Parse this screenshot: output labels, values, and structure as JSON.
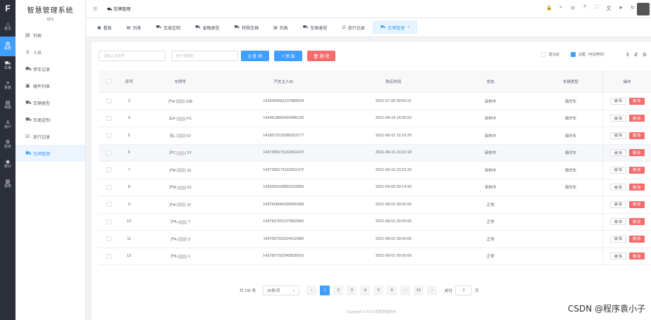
{
  "rail": {
    "logo": "F",
    "items": [
      {
        "icon": "home-icon",
        "glyph": "⌂",
        "label": "首页",
        "active": false
      },
      {
        "icon": "grid-icon",
        "glyph": "▦",
        "label": "系统",
        "active": true
      },
      {
        "icon": "car-icon",
        "glyph": "⛟",
        "label": "车辆",
        "active": false
      },
      {
        "icon": "list-icon",
        "glyph": "≡",
        "label": "看板",
        "active": false
      },
      {
        "icon": "doc-icon",
        "glyph": "▤",
        "label": "档案",
        "active": false
      },
      {
        "icon": "user-icon",
        "glyph": "♙",
        "label": "用户",
        "active": false
      },
      {
        "icon": "setting-icon",
        "glyph": "⚙",
        "label": "财务",
        "active": false
      },
      {
        "icon": "bell-icon",
        "glyph": "◉",
        "label": "统计",
        "active": false
      },
      {
        "icon": "table-icon",
        "glyph": "▥",
        "label": "报表",
        "active": false
      }
    ]
  },
  "side": {
    "title": "智慧管理系统",
    "subtitle": "模块",
    "items": [
      {
        "label": "列表",
        "icon": "▤",
        "active": false
      },
      {
        "label": "人员",
        "icon": "♙",
        "active": false
      },
      {
        "label": "停车记录",
        "icon": "⛟",
        "active": false
      },
      {
        "label": "硬件列表",
        "icon": "▣",
        "active": false
      },
      {
        "label": "车辆类型",
        "icon": "⛟",
        "active": false
      },
      {
        "label": "车类定制",
        "icon": "⛟",
        "active": false
      },
      {
        "label": "放行记录",
        "icon": "☑",
        "active": false
      },
      {
        "label": "车牌管理",
        "icon": "⛟",
        "active": true
      }
    ]
  },
  "navbar": {
    "breadcrumb": "车牌管理",
    "icons": [
      "lock-icon",
      "search-icon",
      "github-icon",
      "question-icon",
      "fullscreen-icon",
      "translate-icon",
      "send-icon",
      "refresh-icon"
    ]
  },
  "tags": [
    {
      "label": "看板",
      "icon": "▣",
      "active": false
    },
    {
      "label": "列表",
      "icon": "▤",
      "active": false
    },
    {
      "label": "车类定制",
      "icon": "⛟",
      "active": false
    },
    {
      "label": "省略类型",
      "icon": "⛟",
      "active": false
    },
    {
      "label": "特殊车辆",
      "icon": "⛟",
      "active": false
    },
    {
      "label": "列表",
      "icon": "▤",
      "active": false
    },
    {
      "label": "车辆类型",
      "icon": "⛟",
      "active": false
    },
    {
      "label": "放行记录",
      "icon": "☑",
      "active": false
    },
    {
      "label": "车牌管理",
      "icon": "⛟",
      "active": true,
      "close": "×"
    }
  ],
  "toolbar": {
    "plate_placeholder": "请输入车牌号",
    "owner_placeholder": "用户或微信",
    "query_label": "Q 查 询",
    "add_label": "+ 添 加",
    "delete_label": "🗑 删 除",
    "zebra_label": "斑马纹",
    "border_label": "边框（可拉伸列）"
  },
  "table": {
    "headers": {
      "index": "序号",
      "plate": "车牌号",
      "owner": "汽车主人ID",
      "time": "购买时间",
      "status": "状态",
      "type": "车辆类型",
      "ops": "操作"
    },
    "edit_label": "编 辑",
    "delete_label": "删 除",
    "rows": [
      {
        "index": "3",
        "plate_a": "沪A",
        "plate_b": "108",
        "owner": "1416069681237889024",
        "time": "2021-07-26 09:50:21",
        "status": "审核中",
        "type": "临时车"
      },
      {
        "index": "4",
        "plate_a": "云A",
        "plate_b": "FC",
        "owner": "1424618860420485120",
        "time": "2021-08-19 14:30:52",
        "status": "审核中",
        "type": "临时车"
      },
      {
        "index": "5",
        "plate_a": "苏L",
        "plate_b": "57",
        "owner": "1418073232085323777",
        "time": "2021-08-15 15:16:29",
        "status": "审核中",
        "type": "临时车"
      },
      {
        "index": "6",
        "plate_a": "沪C",
        "plate_b": "2Y",
        "owner": "1427289175162601472",
        "time": "2021-08-16 23:22:18",
        "status": "审核中",
        "type": "临时车"
      },
      {
        "index": "7",
        "plate_a": "沪B",
        "plate_b": "32",
        "owner": "1427289175162601472",
        "time": "2021-09-16 23:23:20",
        "status": "审核中",
        "type": "临时车"
      },
      {
        "index": "8",
        "plate_a": "沪M",
        "plate_b": "51",
        "owner": "1433559168892153856",
        "time": "2021-09-03 09:14:43",
        "status": "审核中",
        "type": "临时车"
      },
      {
        "index": "9",
        "plate_a": "沪A",
        "plate_b": "37",
        "owner": "1437668584395065368",
        "time": "2021-08-01 00:00:00",
        "status": "正常",
        "type": ""
      },
      {
        "index": "10",
        "plate_a": "沪A",
        "plate_b": "7",
        "owner": "1437697501373992960",
        "time": "2021-08-01 00:00:00",
        "status": "正常",
        "type": ""
      },
      {
        "index": "11",
        "plate_a": "沪A",
        "plate_b": "2",
        "owner": "1437697502024110080",
        "time": "2021-08-01 00:00:00",
        "status": "正常",
        "type": ""
      },
      {
        "index": "12",
        "plate_a": "沪A",
        "plate_b": "1",
        "owner": "1437697502943830016",
        "time": "2021-08-01 00:00:00",
        "status": "正常",
        "type": ""
      }
    ]
  },
  "pager": {
    "total": "共 195 条",
    "size": "20条/页",
    "prev": "‹",
    "pages": [
      "1",
      "2",
      "3",
      "4",
      "5",
      "6",
      "···",
      "10"
    ],
    "next": "›",
    "goto_label": "前往",
    "goto_value": "1",
    "goto_suffix": "页"
  },
  "footer": "Copyright © 2022 智慧管理系统",
  "watermark": "CSDN @程序袁小子"
}
